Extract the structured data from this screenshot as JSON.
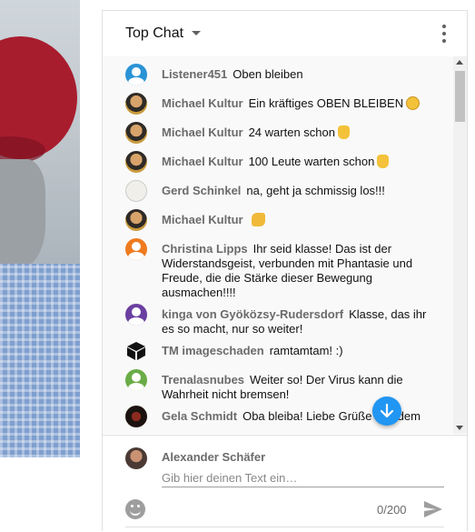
{
  "chat": {
    "title": "Top Chat",
    "messages": [
      {
        "author": "Listener451",
        "text": "Oben bleiben",
        "avatar": "person-icon",
        "color": "#2a93d5"
      },
      {
        "author": "Michael Kultur",
        "text": "Ein kräftiges OBEN BLEIBEN",
        "emoji": "smiling-face-emoji"
      },
      {
        "author": "Michael Kultur",
        "text": "24 warten schon",
        "emoji": "thumbs-up-emoji"
      },
      {
        "author": "Michael Kultur",
        "text": "100 Leute warten schon",
        "emoji": "thumbs-up-emoji"
      },
      {
        "author": "Gerd Schinkel",
        "text": "na, geht ja schmissig los!!!"
      },
      {
        "author": "Michael Kultur",
        "text": "",
        "emoji": "clapping-hands-emoji"
      },
      {
        "author": "Christina Lipps",
        "text": "Ihr seid klasse! Das ist der Widerstandsgeist, verbunden mit Phantasie und Freude, die die Stärke dieser Bewegung ausmachen!!!!",
        "avatar": "person-icon",
        "color": "#ef7b20"
      },
      {
        "author": "kinga von Gyöközsy-Rudersdorf",
        "text": "Klasse, das ihr es so macht, nur so weiter!",
        "avatar": "person-icon",
        "color": "#6a3fa0"
      },
      {
        "author": "TM imageschaden",
        "text": "ramtamtam! :)",
        "avatar": "cube-icon"
      },
      {
        "author": "Trenalasnubes",
        "text": "Weiter so! Der Virus kann die Wahrheit nicht bremsen!",
        "avatar": "person-icon",
        "color": "#6aac46"
      },
      {
        "author": "Gela Schmidt",
        "text": "Oba bleiba! Liebe Grüße aus dem"
      }
    ],
    "composer": {
      "user": "Alexander Schäfer",
      "placeholder": "Gib hier deinen Text ein…",
      "counter": "0/200"
    }
  }
}
